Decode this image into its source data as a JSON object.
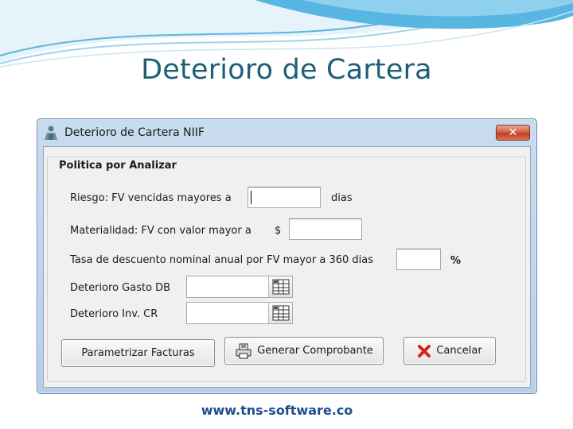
{
  "slide": {
    "title": "Deterioro de Cartera",
    "footer_url": "www.tns-software.co"
  },
  "window": {
    "title": "Deterioro de Cartera NIIF",
    "close_icon": "close-x-icon",
    "group_title": "Politica por Analizar"
  },
  "form": {
    "riesgo_label": "Riesgo: FV vencidas mayores a",
    "riesgo_value": "",
    "riesgo_unit": "dias",
    "materialidad_label": "Materialidad: FV con valor mayor a",
    "materialidad_currency": "$",
    "materialidad_value": "",
    "tasa_label": "Tasa de descuento nominal anual por FV mayor a 360 dias",
    "tasa_value": "",
    "tasa_unit": "%",
    "gasto_label": "Deterioro Gasto DB",
    "gasto_value": "",
    "inv_label": "Deterioro Inv. CR",
    "inv_value": ""
  },
  "buttons": {
    "parametrizar": "Parametrizar Facturas",
    "generar": "Generar Comprobante",
    "cancelar": "Cancelar"
  },
  "colors": {
    "title_text": "#1e5f78",
    "window_frame": "#b8cfe7",
    "cancel_icon": "#d3261c",
    "url_text": "#1f4e8c"
  }
}
